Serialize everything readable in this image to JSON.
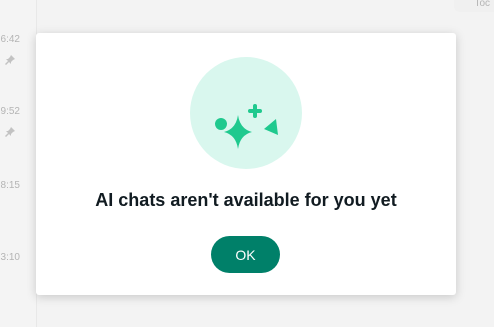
{
  "background": {
    "timestamps": [
      "6:42",
      "9:52",
      "8:15",
      "3:10"
    ],
    "top_right_label": "Toc"
  },
  "modal": {
    "icon": "ai-sparkles-icon",
    "title": "AI chats aren't available for you yet",
    "ok_label": "OK"
  },
  "colors": {
    "accent": "#008069",
    "illustration_bg": "#d9f7ee",
    "illustration_fg": "#1fc98e",
    "text": "#111b21"
  }
}
